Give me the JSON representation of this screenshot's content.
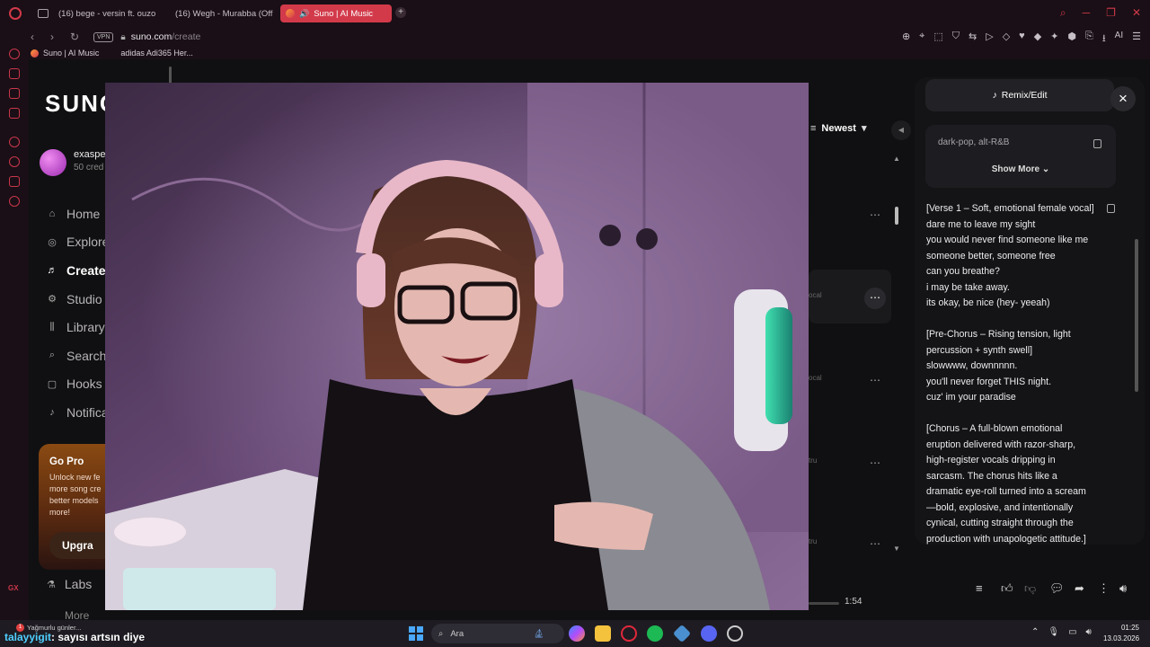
{
  "browser": {
    "tabs": [
      {
        "label": "(16) bege - versin ft. ouzo"
      },
      {
        "label": "(16) Wegh - Murabba (Offi"
      },
      {
        "label": "Suno | AI Music"
      }
    ],
    "vpn_label": "VPN",
    "url_host": "suno.com",
    "url_path": "/create",
    "ai_label": "AI",
    "bookmarks": [
      "Suno | AI Music",
      "adidas Adi365 Her..."
    ],
    "gx_label": "GX"
  },
  "sidebar": {
    "logo": "SUNO",
    "user_name": "exaspe",
    "user_credits": "50 cred",
    "nav": [
      {
        "label": "Home",
        "icon": "home-icon"
      },
      {
        "label": "Explore",
        "icon": "explore-icon"
      },
      {
        "label": "Create",
        "icon": "create-icon"
      },
      {
        "label": "Studio",
        "icon": "studio-icon"
      },
      {
        "label": "Library",
        "icon": "library-icon"
      },
      {
        "label": "Search",
        "icon": "search-icon"
      },
      {
        "label": "Hooks",
        "icon": "hooks-icon"
      },
      {
        "label": "Notifica",
        "icon": "bell-icon"
      }
    ],
    "gopro_title": "Go Pro",
    "gopro_desc": [
      "Unlock new fe",
      "more song cre",
      "better models",
      "more!"
    ],
    "upgrade_label": "Upgra",
    "labs_label": "Labs",
    "more_label": "More"
  },
  "list": {
    "sort_label": "Newest",
    "fragments": [
      "ocal",
      "ocal",
      "tru",
      "tru"
    ]
  },
  "player": {
    "time": "1:54"
  },
  "panel": {
    "remix_label": "Remix/Edit",
    "style_text": "dark-pop, alt-R&B",
    "show_more": "Show More",
    "lyrics": [
      "[Verse 1 – Soft, emotional female vocal]",
      "dare me to leave my sight",
      "you would never find someone like me",
      "someone better, someone free",
      "can you breathe?",
      "i may be take away.",
      "its okay, be nice (hey- yeeah)",
      "",
      "[Pre-Chorus – Rising tension, light",
      "percussion + synth swell]",
      "slowwww, downnnnn.",
      "you'll never forget THIS night.",
      "cuz' im your paradise",
      "",
      "[Chorus – A full-blown emotional",
      "eruption delivered with razor-sharp,",
      "high-register vocals dripping in",
      "sarcasm. The chorus hits like a",
      "dramatic eye-roll turned into a scream",
      "—bold, explosive, and intentionally",
      "cynical, cutting straight through the",
      "production with unapologetic attitude.]"
    ]
  },
  "taskbar": {
    "weather_badge": "1",
    "weather": "Yağmurlu günler...",
    "chat_user": "talayyigit",
    "chat_text": ": sayısı artsın diye",
    "search_label": "Ara",
    "time": "01:25",
    "date": "13.03.2026"
  },
  "colors": {
    "accent": "#d23a4a",
    "page_bg": "#101012",
    "panel_bg": "#141416"
  }
}
